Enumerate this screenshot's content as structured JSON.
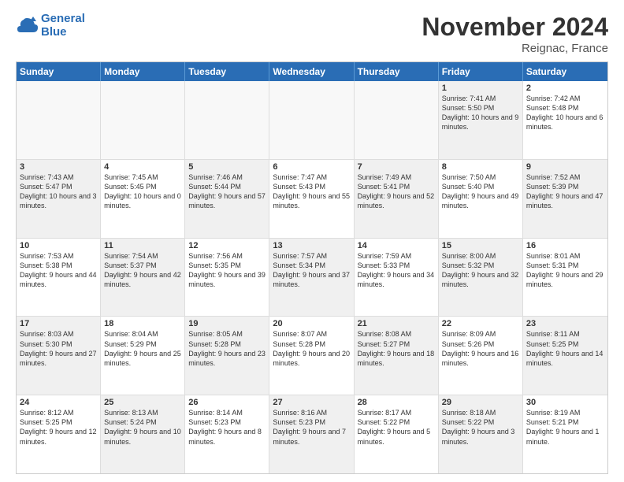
{
  "logo": {
    "line1": "General",
    "line2": "Blue"
  },
  "title": "November 2024",
  "subtitle": "Reignac, France",
  "header_days": [
    "Sunday",
    "Monday",
    "Tuesday",
    "Wednesday",
    "Thursday",
    "Friday",
    "Saturday"
  ],
  "rows": [
    [
      {
        "day": "",
        "text": "",
        "empty": true
      },
      {
        "day": "",
        "text": "",
        "empty": true
      },
      {
        "day": "",
        "text": "",
        "empty": true
      },
      {
        "day": "",
        "text": "",
        "empty": true
      },
      {
        "day": "",
        "text": "",
        "empty": true
      },
      {
        "day": "1",
        "text": "Sunrise: 7:41 AM\nSunset: 5:50 PM\nDaylight: 10 hours and 9 minutes.",
        "shaded": true
      },
      {
        "day": "2",
        "text": "Sunrise: 7:42 AM\nSunset: 5:48 PM\nDaylight: 10 hours and 6 minutes.",
        "shaded": false
      }
    ],
    [
      {
        "day": "3",
        "text": "Sunrise: 7:43 AM\nSunset: 5:47 PM\nDaylight: 10 hours and 3 minutes.",
        "shaded": true
      },
      {
        "day": "4",
        "text": "Sunrise: 7:45 AM\nSunset: 5:45 PM\nDaylight: 10 hours and 0 minutes.",
        "shaded": false
      },
      {
        "day": "5",
        "text": "Sunrise: 7:46 AM\nSunset: 5:44 PM\nDaylight: 9 hours and 57 minutes.",
        "shaded": true
      },
      {
        "day": "6",
        "text": "Sunrise: 7:47 AM\nSunset: 5:43 PM\nDaylight: 9 hours and 55 minutes.",
        "shaded": false
      },
      {
        "day": "7",
        "text": "Sunrise: 7:49 AM\nSunset: 5:41 PM\nDaylight: 9 hours and 52 minutes.",
        "shaded": true
      },
      {
        "day": "8",
        "text": "Sunrise: 7:50 AM\nSunset: 5:40 PM\nDaylight: 9 hours and 49 minutes.",
        "shaded": false
      },
      {
        "day": "9",
        "text": "Sunrise: 7:52 AM\nSunset: 5:39 PM\nDaylight: 9 hours and 47 minutes.",
        "shaded": true
      }
    ],
    [
      {
        "day": "10",
        "text": "Sunrise: 7:53 AM\nSunset: 5:38 PM\nDaylight: 9 hours and 44 minutes.",
        "shaded": false
      },
      {
        "day": "11",
        "text": "Sunrise: 7:54 AM\nSunset: 5:37 PM\nDaylight: 9 hours and 42 minutes.",
        "shaded": true
      },
      {
        "day": "12",
        "text": "Sunrise: 7:56 AM\nSunset: 5:35 PM\nDaylight: 9 hours and 39 minutes.",
        "shaded": false
      },
      {
        "day": "13",
        "text": "Sunrise: 7:57 AM\nSunset: 5:34 PM\nDaylight: 9 hours and 37 minutes.",
        "shaded": true
      },
      {
        "day": "14",
        "text": "Sunrise: 7:59 AM\nSunset: 5:33 PM\nDaylight: 9 hours and 34 minutes.",
        "shaded": false
      },
      {
        "day": "15",
        "text": "Sunrise: 8:00 AM\nSunset: 5:32 PM\nDaylight: 9 hours and 32 minutes.",
        "shaded": true
      },
      {
        "day": "16",
        "text": "Sunrise: 8:01 AM\nSunset: 5:31 PM\nDaylight: 9 hours and 29 minutes.",
        "shaded": false
      }
    ],
    [
      {
        "day": "17",
        "text": "Sunrise: 8:03 AM\nSunset: 5:30 PM\nDaylight: 9 hours and 27 minutes.",
        "shaded": true
      },
      {
        "day": "18",
        "text": "Sunrise: 8:04 AM\nSunset: 5:29 PM\nDaylight: 9 hours and 25 minutes.",
        "shaded": false
      },
      {
        "day": "19",
        "text": "Sunrise: 8:05 AM\nSunset: 5:28 PM\nDaylight: 9 hours and 23 minutes.",
        "shaded": true
      },
      {
        "day": "20",
        "text": "Sunrise: 8:07 AM\nSunset: 5:28 PM\nDaylight: 9 hours and 20 minutes.",
        "shaded": false
      },
      {
        "day": "21",
        "text": "Sunrise: 8:08 AM\nSunset: 5:27 PM\nDaylight: 9 hours and 18 minutes.",
        "shaded": true
      },
      {
        "day": "22",
        "text": "Sunrise: 8:09 AM\nSunset: 5:26 PM\nDaylight: 9 hours and 16 minutes.",
        "shaded": false
      },
      {
        "day": "23",
        "text": "Sunrise: 8:11 AM\nSunset: 5:25 PM\nDaylight: 9 hours and 14 minutes.",
        "shaded": true
      }
    ],
    [
      {
        "day": "24",
        "text": "Sunrise: 8:12 AM\nSunset: 5:25 PM\nDaylight: 9 hours and 12 minutes.",
        "shaded": false
      },
      {
        "day": "25",
        "text": "Sunrise: 8:13 AM\nSunset: 5:24 PM\nDaylight: 9 hours and 10 minutes.",
        "shaded": true
      },
      {
        "day": "26",
        "text": "Sunrise: 8:14 AM\nSunset: 5:23 PM\nDaylight: 9 hours and 8 minutes.",
        "shaded": false
      },
      {
        "day": "27",
        "text": "Sunrise: 8:16 AM\nSunset: 5:23 PM\nDaylight: 9 hours and 7 minutes.",
        "shaded": true
      },
      {
        "day": "28",
        "text": "Sunrise: 8:17 AM\nSunset: 5:22 PM\nDaylight: 9 hours and 5 minutes.",
        "shaded": false
      },
      {
        "day": "29",
        "text": "Sunrise: 8:18 AM\nSunset: 5:22 PM\nDaylight: 9 hours and 3 minutes.",
        "shaded": true
      },
      {
        "day": "30",
        "text": "Sunrise: 8:19 AM\nSunset: 5:21 PM\nDaylight: 9 hours and 1 minute.",
        "shaded": false
      }
    ]
  ]
}
